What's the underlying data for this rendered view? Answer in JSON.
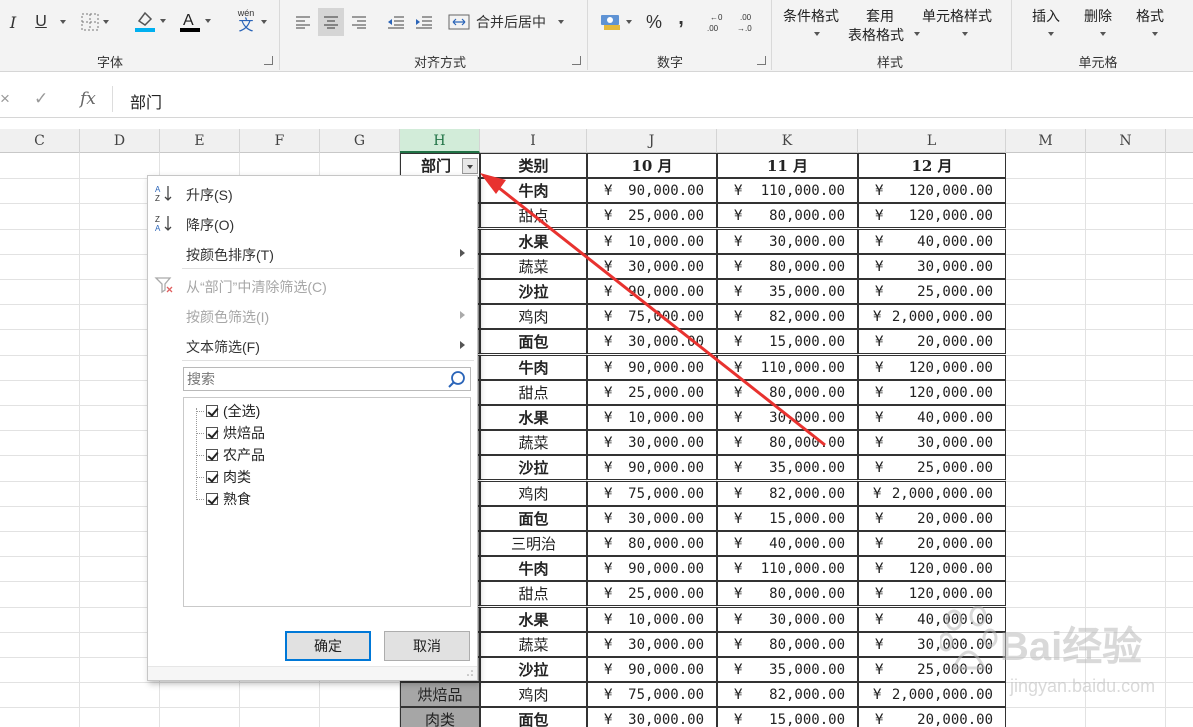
{
  "ribbon": {
    "groups": {
      "font": "字体",
      "alignment": "对齐方式",
      "number": "数字",
      "styles": "样式",
      "cells": "单元格"
    },
    "font_buttons": {
      "italic": "I",
      "underline": "U"
    },
    "pinyin_top": "wén",
    "pinyin_bottom": "文",
    "merge_center": "合并后居中",
    "percent": "%",
    "comma": ",",
    "inc_decimal": ".00",
    "dec_decimal": ".00",
    "conditional_format": "条件格式",
    "apply_table_line1": "套用",
    "apply_table_line2": "表格格式",
    "cell_styles": "单元格样式",
    "insert": "插入",
    "delete": "删除",
    "format": "格式"
  },
  "formula_bar": {
    "cancel_icon": "×",
    "confirm_icon": "✓",
    "fx": "fx",
    "content": "部门"
  },
  "columns": [
    "C",
    "D",
    "E",
    "F",
    "G",
    "H",
    "I",
    "J",
    "K",
    "L",
    "M",
    "N"
  ],
  "table": {
    "header": {
      "dept": "部门",
      "category": "类别",
      "oct": "10 月",
      "nov": "11 月",
      "dec": "12 月"
    },
    "rows": [
      {
        "cat": "牛肉",
        "bold": true,
        "oct": "90,000.00",
        "nov": "110,000.00",
        "dec": "120,000.00"
      },
      {
        "cat": "甜点",
        "bold": false,
        "oct": "25,000.00",
        "nov": "80,000.00",
        "dec": "120,000.00"
      },
      {
        "cat": "水果",
        "bold": true,
        "oct": "10,000.00",
        "nov": "30,000.00",
        "dec": "40,000.00"
      },
      {
        "cat": "蔬菜",
        "bold": false,
        "oct": "30,000.00",
        "nov": "80,000.00",
        "dec": "30,000.00"
      },
      {
        "cat": "沙拉",
        "bold": true,
        "oct": "90,000.00",
        "nov": "35,000.00",
        "dec": "25,000.00"
      },
      {
        "cat": "鸡肉",
        "bold": false,
        "oct": "75,000.00",
        "nov": "82,000.00",
        "dec": "2,000,000.00"
      },
      {
        "cat": "面包",
        "bold": true,
        "oct": "30,000.00",
        "nov": "15,000.00",
        "dec": "20,000.00"
      },
      {
        "cat": "牛肉",
        "bold": true,
        "oct": "90,000.00",
        "nov": "110,000.00",
        "dec": "120,000.00"
      },
      {
        "cat": "甜点",
        "bold": false,
        "oct": "25,000.00",
        "nov": "80,000.00",
        "dec": "120,000.00"
      },
      {
        "cat": "水果",
        "bold": true,
        "oct": "10,000.00",
        "nov": "30,000.00",
        "dec": "40,000.00"
      },
      {
        "cat": "蔬菜",
        "bold": false,
        "oct": "30,000.00",
        "nov": "80,000.00",
        "dec": "30,000.00"
      },
      {
        "cat": "沙拉",
        "bold": true,
        "oct": "90,000.00",
        "nov": "35,000.00",
        "dec": "25,000.00"
      },
      {
        "cat": "鸡肉",
        "bold": false,
        "oct": "75,000.00",
        "nov": "82,000.00",
        "dec": "2,000,000.00"
      },
      {
        "cat": "面包",
        "bold": true,
        "oct": "30,000.00",
        "nov": "15,000.00",
        "dec": "20,000.00"
      },
      {
        "cat": "三明治",
        "bold": false,
        "oct": "80,000.00",
        "nov": "40,000.00",
        "dec": "20,000.00"
      },
      {
        "cat": "牛肉",
        "bold": true,
        "oct": "90,000.00",
        "nov": "110,000.00",
        "dec": "120,000.00"
      },
      {
        "cat": "甜点",
        "bold": false,
        "oct": "25,000.00",
        "nov": "80,000.00",
        "dec": "120,000.00"
      },
      {
        "cat": "水果",
        "bold": true,
        "oct": "10,000.00",
        "nov": "30,000.00",
        "dec": "40,000.00"
      },
      {
        "cat": "蔬菜",
        "bold": false,
        "oct": "30,000.00",
        "nov": "80,000.00",
        "dec": "30,000.00"
      },
      {
        "cat": "沙拉",
        "bold": true,
        "oct": "90,000.00",
        "nov": "35,000.00",
        "dec": "25,000.00"
      },
      {
        "cat": "鸡肉",
        "bold": false,
        "oct": "75,000.00",
        "nov": "82,000.00",
        "dec": "2,000,000.00"
      },
      {
        "cat": "面包",
        "bold": true,
        "oct": "30,000.00",
        "nov": "15,000.00",
        "dec": "20,000.00"
      }
    ],
    "currency": "¥",
    "visible_dept_cells": [
      "烘焙品",
      "肉类"
    ]
  },
  "filter_menu": {
    "sort_asc": "升序(S)",
    "sort_desc": "降序(O)",
    "sort_by_color": "按颜色排序(T)",
    "clear_filter": "从“部门”中清除筛选(C)",
    "filter_by_color": "按颜色筛选(I)",
    "text_filter": "文本筛选(F)",
    "search_placeholder": "搜索",
    "items": [
      "(全选)",
      "烘焙品",
      "农产品",
      "肉类",
      "熟食"
    ],
    "ok": "确定",
    "cancel": "取消"
  },
  "watermark": {
    "brand": "Bai经验",
    "url": "jingyan.baidu.com"
  },
  "colors": {
    "accent_green": "#217346",
    "arrow_red": "#e8322f",
    "dept_fill": "#a6a6a6",
    "ok_border": "#0078d7"
  }
}
